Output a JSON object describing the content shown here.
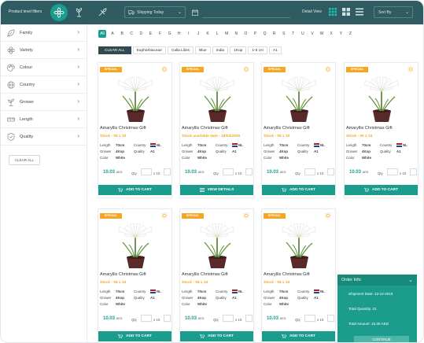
{
  "header": {
    "filters_label": "Product level filters",
    "shipping": "Shipping Today",
    "detail_view": "Detail View",
    "sort_by": "Sort By"
  },
  "sidebar": {
    "filters": [
      {
        "label": "Family",
        "icon": "leaf-icon"
      },
      {
        "label": "Variety",
        "icon": "flower-icon"
      },
      {
        "label": "Colour",
        "icon": "palette-icon"
      },
      {
        "label": "Country",
        "icon": "globe-icon"
      },
      {
        "label": "Grower",
        "icon": "sprout-icon"
      },
      {
        "label": "Length",
        "icon": "ruler-icon"
      },
      {
        "label": "Quality",
        "icon": "badge-icon"
      }
    ],
    "clear_all": "CLEAR ALL"
  },
  "alphabet": [
    "All",
    "A",
    "B",
    "C",
    "D",
    "E",
    "F",
    "G",
    "H",
    "I",
    "J",
    "K",
    "L",
    "M",
    "N",
    "O",
    "P",
    "Q",
    "R",
    "S",
    "T",
    "U",
    "V",
    "W",
    "X",
    "Y",
    "Z"
  ],
  "chips": [
    "CLEAR ALL",
    "Euphorbiaceae",
    "Calla Lilies",
    "Blue",
    "India",
    "1Kop",
    "1-5 cm",
    "A1"
  ],
  "product_labels": {
    "length": "Length",
    "country": "Country",
    "grower": "Grower",
    "quality": "Quality",
    "color": "Color",
    "qty": "Qty",
    "currency": "AED"
  },
  "cards": [
    {
      "badge": "SPECIAL",
      "name": "Amaryllis Christmas Gift",
      "stock": "Stock - 05 x 10",
      "length": "70cm",
      "country": "NL",
      "grower": "4Kop",
      "quality": "A1",
      "color": "White",
      "price": "10.03",
      "multiplier": "x 10",
      "cta": "ADD TO CART"
    },
    {
      "badge": "SPECIAL",
      "name": "Amaryllis Christmas Gift",
      "stock": "Stock available date - 18/03/2020",
      "length": "70cm",
      "country": "NL",
      "grower": "4Kop",
      "quality": "A1",
      "color": "White",
      "price": "10.03",
      "multiplier": "x 10",
      "cta": "VIEW DETAILS"
    },
    {
      "badge": "SPECIAL",
      "name": "Amaryllis Christmas Gift",
      "stock": "Stock - 05 x 10",
      "length": "70cm",
      "country": "NL",
      "grower": "4Kop",
      "quality": "A1",
      "color": "White",
      "price": "10.03",
      "multiplier": "x 10",
      "cta": "ADD TO CART"
    },
    {
      "badge": "SPECIAL",
      "name": "Amaryllis Christmas Gift",
      "stock": "Stock - 05 x 10",
      "length": "70cm",
      "country": "NL",
      "grower": "4Kop",
      "quality": "A1",
      "color": "White",
      "price": "10.03",
      "multiplier": "x 10",
      "cta": "ADD TO CART"
    },
    {
      "badge": "SPECIAL",
      "name": "Amaryllis Christmas Gift",
      "stock": "Stock - 05 x 10",
      "length": "70cm",
      "country": "NL",
      "grower": "4Kop",
      "quality": "A1",
      "color": "White",
      "price": "10.03",
      "multiplier": "x 10",
      "cta": "ADD TO CART"
    },
    {
      "badge": "SPECIAL",
      "name": "Amaryllis Christmas Gift",
      "stock": "Stock - 05 x 10",
      "length": "70cm",
      "country": "NL",
      "grower": "4Kop",
      "quality": "A1",
      "color": "White",
      "price": "10.03",
      "multiplier": "x 10",
      "cta": "ADD TO CART"
    },
    {
      "badge": "SPECIAL",
      "name": "Amaryllis Christmas Gift",
      "stock": "Stock - 05 x 10",
      "length": "70cm",
      "country": "NL",
      "grower": "4Kop",
      "quality": "A1",
      "color": "White",
      "price": "10.03",
      "multiplier": "x 10",
      "cta": "ADD TO CART"
    }
  ],
  "order_info": {
    "title": "Order Info",
    "shipment_date": "Shipment Date: 13-12-2019",
    "total_quantity": "Total Quantity: 01",
    "total_amount": "Total Amount: 15.00 AED",
    "continue": "CONTINUE"
  },
  "colors": {
    "header_bg": "#2f5b62",
    "accent": "#1c9c8c",
    "badge": "#f5a623",
    "stock_text": "#f5a623"
  }
}
